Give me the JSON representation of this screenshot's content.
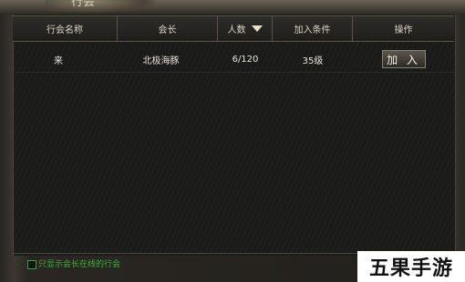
{
  "window": {
    "title": "行会"
  },
  "table": {
    "columns": [
      "行会名称",
      "会长",
      "人数",
      "加入条件",
      "操作"
    ],
    "rows": [
      {
        "name": "来",
        "leader": "北极海豚",
        "members": "6/120",
        "condition": "35级",
        "action_label": "加 入"
      }
    ]
  },
  "filter": {
    "online_only_label": "只显示会长在线的行会",
    "checked": false
  },
  "watermark": "五果手游",
  "colors": {
    "accent_green": "#3bb33b",
    "header_text": "#d9d4c6",
    "panel_bg": "#1a1a18"
  }
}
